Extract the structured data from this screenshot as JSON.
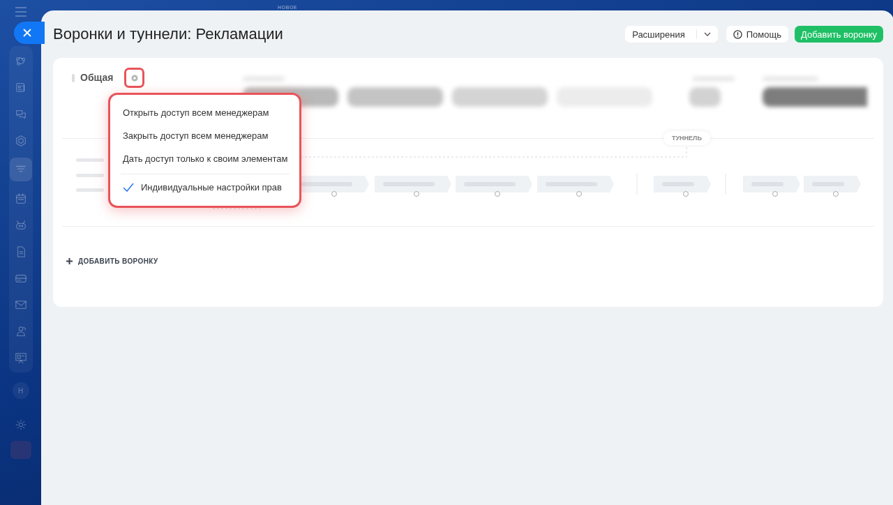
{
  "top_label": "НОВОЕ",
  "sidebar": {
    "items": [
      {
        "kind": "nodes",
        "selected": false
      },
      {
        "kind": "news",
        "selected": false
      },
      {
        "kind": "chat",
        "selected": false
      },
      {
        "kind": "hexagon",
        "selected": false
      },
      {
        "kind": "funnel",
        "selected": true
      },
      {
        "kind": "calendar",
        "selected": false
      },
      {
        "kind": "robot",
        "selected": false
      },
      {
        "kind": "document",
        "selected": false
      },
      {
        "kind": "card",
        "selected": false
      },
      {
        "kind": "mail",
        "selected": false
      },
      {
        "kind": "people",
        "selected": false
      },
      {
        "kind": "board",
        "selected": false
      }
    ],
    "avatar": "Н"
  },
  "title": "Воронки и туннели: Рекламации",
  "header_buttons": {
    "extensions": "Расширения",
    "help": "Помощь",
    "add": "Добавить воронку"
  },
  "funnel": {
    "name": "Общая",
    "tunnel_label": "ТУННЕЛЬ"
  },
  "menu": {
    "items": [
      {
        "label": "Открыть доступ всем менеджерам",
        "checked": false,
        "divider_before": false
      },
      {
        "label": "Закрыть доступ всем менеджерам",
        "checked": false,
        "divider_before": false
      },
      {
        "label": "Дать доступ только к своим элементам",
        "checked": false,
        "divider_before": false
      },
      {
        "label": "Индивидуальные настройки прав",
        "checked": true,
        "divider_before": true
      }
    ]
  },
  "add_funnel_link": "ДОБАВИТЬ ВОРОНКУ"
}
